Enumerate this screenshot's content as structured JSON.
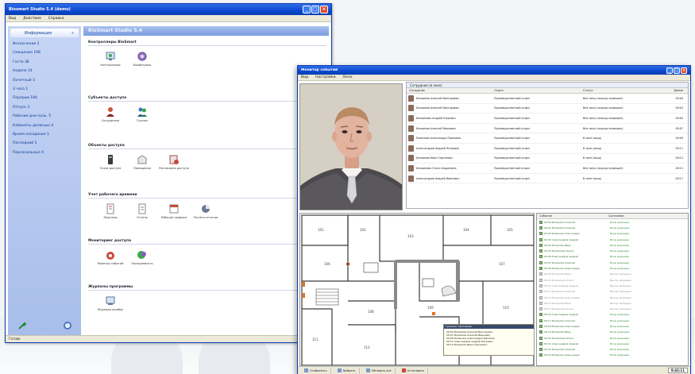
{
  "window1": {
    "title": "Biosmart Studio 5.4 (demo)",
    "menu": [
      "Вид",
      "Действия",
      "Справка"
    ],
    "sidebar": {
      "header": "Информация",
      "items": [
        "Исключения 2",
        "Смещения 198",
        "Гости 38",
        "Неделя 14",
        "Почетный 3",
        "3 часа 1",
        "Перерыв 184",
        "Отпуск 3",
        "Рабочие дни поль. 5",
        "Кабинеты должных 4",
        "Время опоздания 1",
        "Последний 5",
        "Персональные 4"
      ]
    },
    "main_title": "BioSmart Studio 5.4",
    "sections": [
      {
        "title": "Контроллеры BioSmart",
        "items": [
          "Контроллеры",
          "Биометрика"
        ]
      },
      {
        "title": "Субъекты доступа",
        "items": [
          "Сотрудники",
          "Группы"
        ]
      },
      {
        "title": "Объекты доступа",
        "items": [
          "Точки доступа",
          "Помещения",
          "Расписания доступа"
        ]
      },
      {
        "title": "Учет рабочего времени",
        "items": [
          "Журналы",
          "Отчеты",
          "Рабочие графики",
          "Расчеты отчетов"
        ]
      },
      {
        "title": "Мониторинг доступа",
        "items": [
          "Монитор событий",
          "Посещаемость"
        ]
      },
      {
        "title": "Журналы программы",
        "items": [
          "Журналы ошибок"
        ]
      }
    ],
    "status": "Готово"
  },
  "window2": {
    "title": "Монитор событий",
    "menu": [
      "Вид",
      "Настройки",
      "Окно"
    ],
    "tab_label": "Сотрудник (в зоне)",
    "columns": [
      "Сотрудник",
      "Отдел",
      "Статус",
      "Время"
    ],
    "rows": [
      {
        "name": "Исмаилов Алексей Викторович",
        "dept": "Производственный отдел",
        "status": "Вне зоны (проход запрещен)",
        "time": "09:00"
      },
      {
        "name": "Исмаилов Алексей Викторович",
        "dept": "Производственный отдел",
        "status": "Вне зоны (проход запрещен)",
        "time": "09:03"
      },
      {
        "name": "Исмаилова Андрей Юрьевич",
        "dept": "Производственный отдел",
        "status": "Вне зоны (проход запрещен)",
        "time": "09:05"
      },
      {
        "name": "Исмаилов Алексей Иванович",
        "dept": "Производственный отдел",
        "status": "Вне зоны (проход запрещен)",
        "time": "09:07"
      },
      {
        "name": "Романова Александра Павловна",
        "dept": "Производственный отдел",
        "status": "В зоне (вход)",
        "time": "09:09"
      },
      {
        "name": "Александров Андрей Петрович",
        "dept": "Производственный отдел",
        "status": "В зоне (вход)",
        "time": "09:11"
      },
      {
        "name": "Исмаилов Иван Сергеевич",
        "dept": "Производственный отдел",
        "status": "В зоне (вход)",
        "time": "09:13"
      },
      {
        "name": "Исмаилова Ольга Андреевна",
        "dept": "Производственный отдел",
        "status": "Вне зоны (проход запрещен)",
        "time": "09:15"
      },
      {
        "name": "Александров Андрей Иванович",
        "dept": "Производственный отдел",
        "status": "В зоне (вход)",
        "time": "09:17"
      }
    ],
    "tooltip": {
      "header": "Турникет проходная",
      "lines": [
        "09:05  Исмаилов Алексей Викторович",
        "09:07  Исмаилов Алексей Иванович",
        "09:09  Романова Александра Павловна",
        "09:11  Александров Андрей Петрович",
        "09:13  Исмаилов Иван Сергеевич"
      ]
    },
    "events_columns": [
      "Событие",
      "Состояние"
    ],
    "events": [
      {
        "t": "09:00 Исмаилов Алексей",
        "s": "Вход разрешен",
        "g": false
      },
      {
        "t": "09:01 Исмаилов Алексей",
        "s": "Вход разрешен",
        "g": false
      },
      {
        "t": "09:02 Романова Александра",
        "s": "Вход разрешен",
        "g": false
      },
      {
        "t": "09:03 Александров Андрей",
        "s": "Вход разрешен",
        "g": false
      },
      {
        "t": "09:04 Исмаилов Иван",
        "s": "Вход разрешен",
        "g": false
      },
      {
        "t": "09:05 Исмаилова Ольга",
        "s": "Вход разрешен",
        "g": false
      },
      {
        "t": "09:06 Александров Андрей",
        "s": "Вход разрешен",
        "g": false
      },
      {
        "t": "09:07 Исмаилов Алексей",
        "s": "Вход разрешен",
        "g": false
      },
      {
        "t": "09:08 Романова Александра",
        "s": "Вход разрешен",
        "g": false
      },
      {
        "t": "09:09 Исмаилов Иван",
        "s": "Выход запрещен",
        "g": true
      },
      {
        "t": "09:10 Исмаилова Ольга",
        "s": "Выход запрещен",
        "g": true
      },
      {
        "t": "09:11 Александров Андрей",
        "s": "Выход запрещен",
        "g": true
      },
      {
        "t": "09:12 Исмаилов Алексей",
        "s": "Выход запрещен",
        "g": true
      },
      {
        "t": "09:13 Романова Александра",
        "s": "Выход запрещен",
        "g": true
      },
      {
        "t": "09:14 Исмаилов Иван",
        "s": "Выход запрещен",
        "g": true
      },
      {
        "t": "09:15 Исмаилова Ольга",
        "s": "Выход запрещен",
        "g": true
      },
      {
        "t": "09:16 Александров Андрей",
        "s": "Вход разрешен",
        "g": false
      },
      {
        "t": "09:17 Исмаилов Алексей",
        "s": "Вход разрешен",
        "g": false
      },
      {
        "t": "09:18 Романова Александра",
        "s": "Вход разрешен",
        "g": false
      },
      {
        "t": "09:19 Исмаилов Иван",
        "s": "Вход разрешен",
        "g": false
      },
      {
        "t": "09:20 Исмаилова Ольга",
        "s": "Вход разрешен",
        "g": false
      },
      {
        "t": "09:21 Александров Андрей",
        "s": "Вход разрешен",
        "g": false
      },
      {
        "t": "09:22 Исмаилов Алексей",
        "s": "Вход разрешен",
        "g": false
      },
      {
        "t": "09:23 Романова Александра",
        "s": "Вход разрешен",
        "g": false
      }
    ],
    "bottom_buttons": [
      "Отобразить",
      "Выбрать",
      "Обновить всё",
      "Остановить"
    ],
    "clock": "9:42:11"
  }
}
